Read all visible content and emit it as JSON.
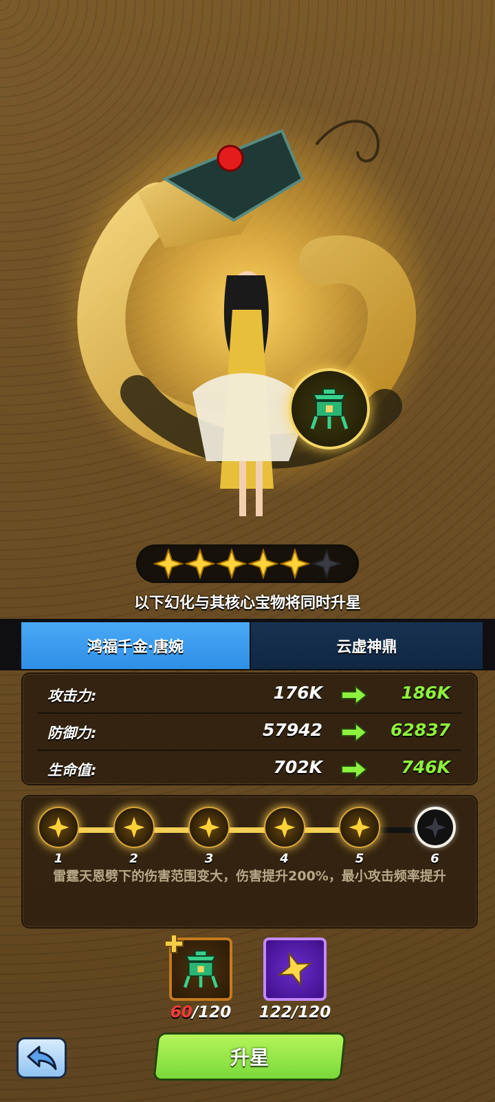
{
  "hero": {
    "stars_total": 6,
    "stars_filled": 5
  },
  "upgrade_note": "以下幻化与其核心宝物将同时升星",
  "tabs": [
    {
      "label": "鸿福千金·唐婉",
      "active": true
    },
    {
      "label": "云虚神鼎",
      "active": false
    }
  ],
  "stats": [
    {
      "label": "攻击力:",
      "current": "176K",
      "next": "186K"
    },
    {
      "label": "防御力:",
      "current": "57942",
      "next": "62837"
    },
    {
      "label": "生命值:",
      "current": "702K",
      "next": "746K"
    }
  ],
  "levels": {
    "items": [
      {
        "num": "1",
        "unlocked": true
      },
      {
        "num": "2",
        "unlocked": true
      },
      {
        "num": "3",
        "unlocked": true
      },
      {
        "num": "4",
        "unlocked": true
      },
      {
        "num": "5",
        "unlocked": true
      },
      {
        "num": "6",
        "unlocked": false
      }
    ],
    "description": "雷霆天恩劈下的伤害范围变大，伤害提升200%，最小攻击频率提升"
  },
  "materials": [
    {
      "icon": "core-treasure-icon",
      "have": "60",
      "need": "/120",
      "have_color": "#ff3b3b"
    },
    {
      "icon": "star-shard-icon",
      "have": "122",
      "need": "/120",
      "have_color": "#ffffff"
    }
  ],
  "buttons": {
    "upstar_label": "升星",
    "back_icon": "back-arrow-icon"
  },
  "colors": {
    "accent_tab": "#2f8fe6",
    "stat_increase": "#8df23e",
    "upstar_button": "#7bd93a",
    "insufficient": "#ff3b3b"
  }
}
